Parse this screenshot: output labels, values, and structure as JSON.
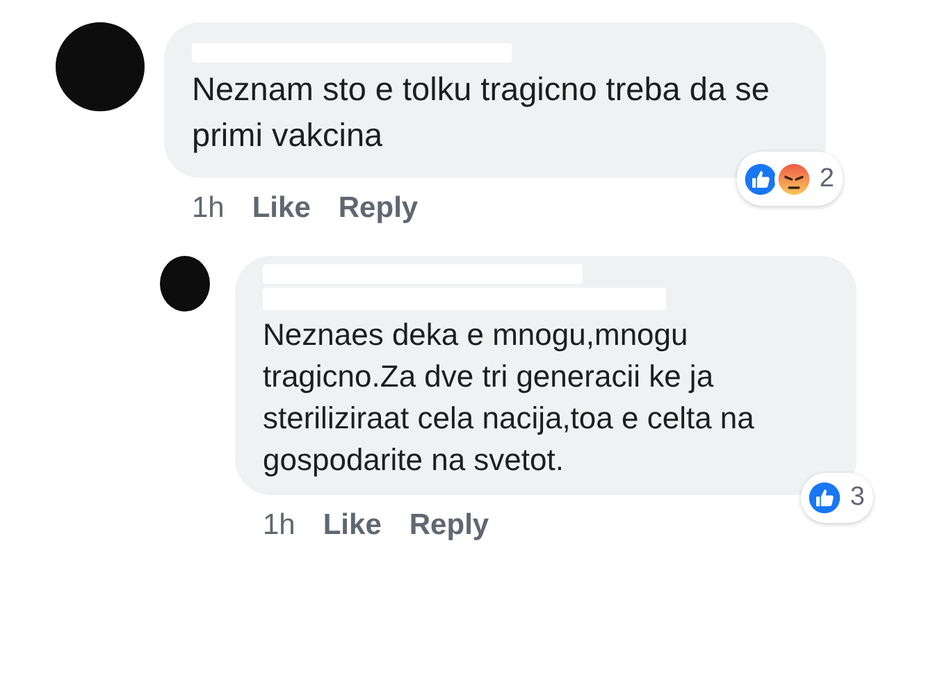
{
  "comments": [
    {
      "text": "Neznam sto e tolku tragicno treba da se primi vakcina",
      "time": "1h",
      "actions": [
        "Like",
        "Reply"
      ],
      "reactions": [
        {
          "kind": "like"
        },
        {
          "kind": "angry"
        }
      ],
      "reaction_count": "2",
      "reply": false
    },
    {
      "text": "Neznaes deka e mnogu,mnogu tragicno.Za dve tri generacii ke ja steriliziraat cela nacija,toa e celta na gospodarite na svetot.",
      "time": "1h",
      "actions": [
        "Like",
        "Reply"
      ],
      "reactions": [
        {
          "kind": "like"
        }
      ],
      "reaction_count": "3",
      "reply": true
    }
  ]
}
